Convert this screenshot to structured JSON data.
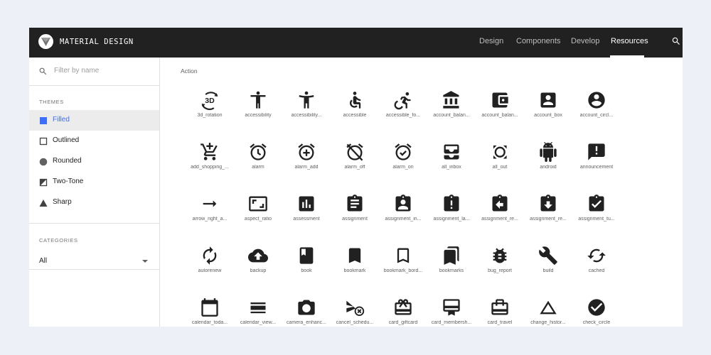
{
  "header": {
    "brand": "MATERIAL DESIGN",
    "nav": [
      "Design",
      "Components",
      "Develop",
      "Resources"
    ],
    "active_nav": "Resources"
  },
  "sidebar": {
    "search_placeholder": "Filter by name",
    "themes_title": "THEMES",
    "themes": [
      "Filled",
      "Outlined",
      "Rounded",
      "Two-Tone",
      "Sharp"
    ],
    "active_theme": "Filled",
    "categories_title": "CATEGORIES",
    "category_value": "All"
  },
  "main": {
    "category": "Action",
    "icons": [
      {
        "label": "3d_rotation",
        "icon": "3d-rotation-icon"
      },
      {
        "label": "accessibility",
        "icon": "accessibility-icon"
      },
      {
        "label": "accessibility...",
        "icon": "accessibility-new-icon"
      },
      {
        "label": "accessible",
        "icon": "accessible-icon"
      },
      {
        "label": "accessible_fo...",
        "icon": "accessible-forward-icon"
      },
      {
        "label": "account_balan...",
        "icon": "account-balance-icon"
      },
      {
        "label": "account_balan...",
        "icon": "account-balance-wallet-icon"
      },
      {
        "label": "account_box",
        "icon": "account-box-icon"
      },
      {
        "label": "account_circl...",
        "icon": "account-circle-icon"
      },
      {
        "label": "add_shopping_...",
        "icon": "add-shopping-cart-icon"
      },
      {
        "label": "alarm",
        "icon": "alarm-icon"
      },
      {
        "label": "alarm_add",
        "icon": "alarm-add-icon"
      },
      {
        "label": "alarm_off",
        "icon": "alarm-off-icon"
      },
      {
        "label": "alarm_on",
        "icon": "alarm-on-icon"
      },
      {
        "label": "all_inbox",
        "icon": "all-inbox-icon"
      },
      {
        "label": "all_out",
        "icon": "all-out-icon"
      },
      {
        "label": "android",
        "icon": "android-icon"
      },
      {
        "label": "announcement",
        "icon": "announcement-icon"
      },
      {
        "label": "arrow_right_a...",
        "icon": "arrow-right-alt-icon"
      },
      {
        "label": "aspect_ratio",
        "icon": "aspect-ratio-icon"
      },
      {
        "label": "assessment",
        "icon": "assessment-icon"
      },
      {
        "label": "assignment",
        "icon": "assignment-icon"
      },
      {
        "label": "assignment_in...",
        "icon": "assignment-ind-icon"
      },
      {
        "label": "assignment_la...",
        "icon": "assignment-late-icon"
      },
      {
        "label": "assignment_re...",
        "icon": "assignment-return-icon"
      },
      {
        "label": "assignment_re...",
        "icon": "assignment-returned-icon"
      },
      {
        "label": "assignment_tu...",
        "icon": "assignment-turned-in-icon"
      },
      {
        "label": "autorenew",
        "icon": "autorenew-icon"
      },
      {
        "label": "backup",
        "icon": "backup-icon"
      },
      {
        "label": "book",
        "icon": "book-icon"
      },
      {
        "label": "bookmark",
        "icon": "bookmark-icon"
      },
      {
        "label": "bookmark_bord...",
        "icon": "bookmark-border-icon"
      },
      {
        "label": "bookmarks",
        "icon": "bookmarks-icon"
      },
      {
        "label": "bug_report",
        "icon": "bug-report-icon"
      },
      {
        "label": "build",
        "icon": "build-icon"
      },
      {
        "label": "cached",
        "icon": "cached-icon"
      },
      {
        "label": "calendar_toda...",
        "icon": "calendar-today-icon"
      },
      {
        "label": "calendar_view...",
        "icon": "calendar-view-day-icon"
      },
      {
        "label": "camera_enhanc...",
        "icon": "camera-enhance-icon"
      },
      {
        "label": "cancel_schedu...",
        "icon": "cancel-schedule-send-icon"
      },
      {
        "label": "card_giftcard",
        "icon": "card-giftcard-icon"
      },
      {
        "label": "card_membersh...",
        "icon": "card-membership-icon"
      },
      {
        "label": "card_travel",
        "icon": "card-travel-icon"
      },
      {
        "label": "change_histor...",
        "icon": "change-history-icon"
      },
      {
        "label": "check_circle",
        "icon": "check-circle-icon"
      }
    ]
  }
}
